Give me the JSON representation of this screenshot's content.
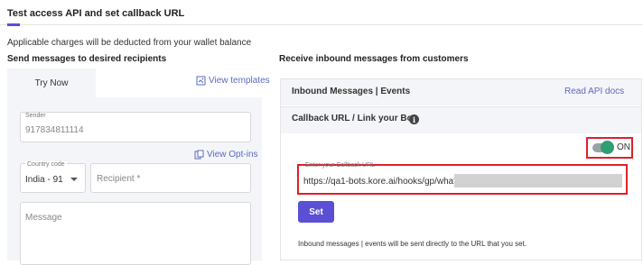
{
  "header": {
    "title": "Test access API and set callback URL"
  },
  "notice": "Applicable charges will be deducted from your wallet balance",
  "send": {
    "section_title": "Send messages to desired recipients",
    "tab_label": "Try Now",
    "view_templates": "View templates",
    "sender_label": "Sender",
    "sender_value": "917834811114",
    "view_optins": "View Opt-ins",
    "country_label": "Country code",
    "country_value": "India - 91",
    "recipient_placeholder": "Recipient *",
    "message_placeholder": "Message"
  },
  "receive": {
    "section_title": "Receive inbound messages from customers",
    "inbound_title": "Inbound Messages | Events",
    "read_api_docs": "Read API docs",
    "callback_title": "Callback URL / Link your Bot",
    "toggle_label": "ON",
    "toggle_on": true,
    "url_label": "Enter your Callback URL",
    "url_value": "https://qa1-bots.kore.ai/hooks/gp/whatsapp/",
    "set_label": "Set",
    "note": "Inbound messages | events will be sent directly to the URL that you set."
  },
  "colors": {
    "accent": "#5b4fd6",
    "link": "#5b6bc0",
    "highlight": "#e0202a",
    "toggle": "#2e9e73"
  }
}
